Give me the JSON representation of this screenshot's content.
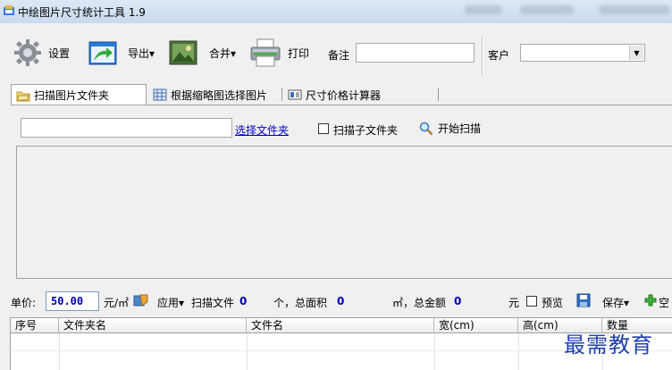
{
  "window": {
    "title": "中绘图片尺寸统计工具 1.9"
  },
  "toolbar": {
    "settings_label": "设置",
    "export_label": "导出▾",
    "merge_label": "合并▾",
    "print_label": "打印",
    "note_label": "备注",
    "note_value": "",
    "customer_label": "客户",
    "customer_value": ""
  },
  "tabs": [
    {
      "label": "扫描图片文件夹",
      "active": true,
      "icon": "folder-icon"
    },
    {
      "label": "根据缩略图选择图片",
      "active": false,
      "icon": "grid-icon"
    },
    {
      "label": "尺寸价格计算器",
      "active": false,
      "icon": "calculator-icon"
    }
  ],
  "scan_panel": {
    "path_value": "",
    "choose_folder_label": "选择文件夹",
    "scan_subfolders_label": "扫描子文件夹",
    "scan_subfolders_checked": false,
    "start_scan_label": "开始扫描"
  },
  "status": {
    "unit_price_label": "单价:",
    "unit_price_value": "50.00",
    "unit_label": "元/㎡",
    "apply_label": "应用▾",
    "scanned_files_label": "扫描文件",
    "scanned_files_value": "0",
    "total_area_label": "个，总面积",
    "total_area_value": "0",
    "total_amount_label": "㎡，总金额",
    "total_amount_value": "0",
    "currency_label": "元",
    "preview_label": "预览",
    "preview_checked": false,
    "save_label": "保存▾",
    "clear_label": "空"
  },
  "table": {
    "columns": [
      "序号",
      "文件夹名",
      "文件名",
      "宽(cm)",
      "高(cm)",
      "数量"
    ],
    "rows": []
  },
  "watermark": "最需教育",
  "colors": {
    "title_bar": "#c9daee",
    "link": "#0000cc",
    "value_blue": "#0000b0",
    "watermark": "#1f3fb0"
  }
}
